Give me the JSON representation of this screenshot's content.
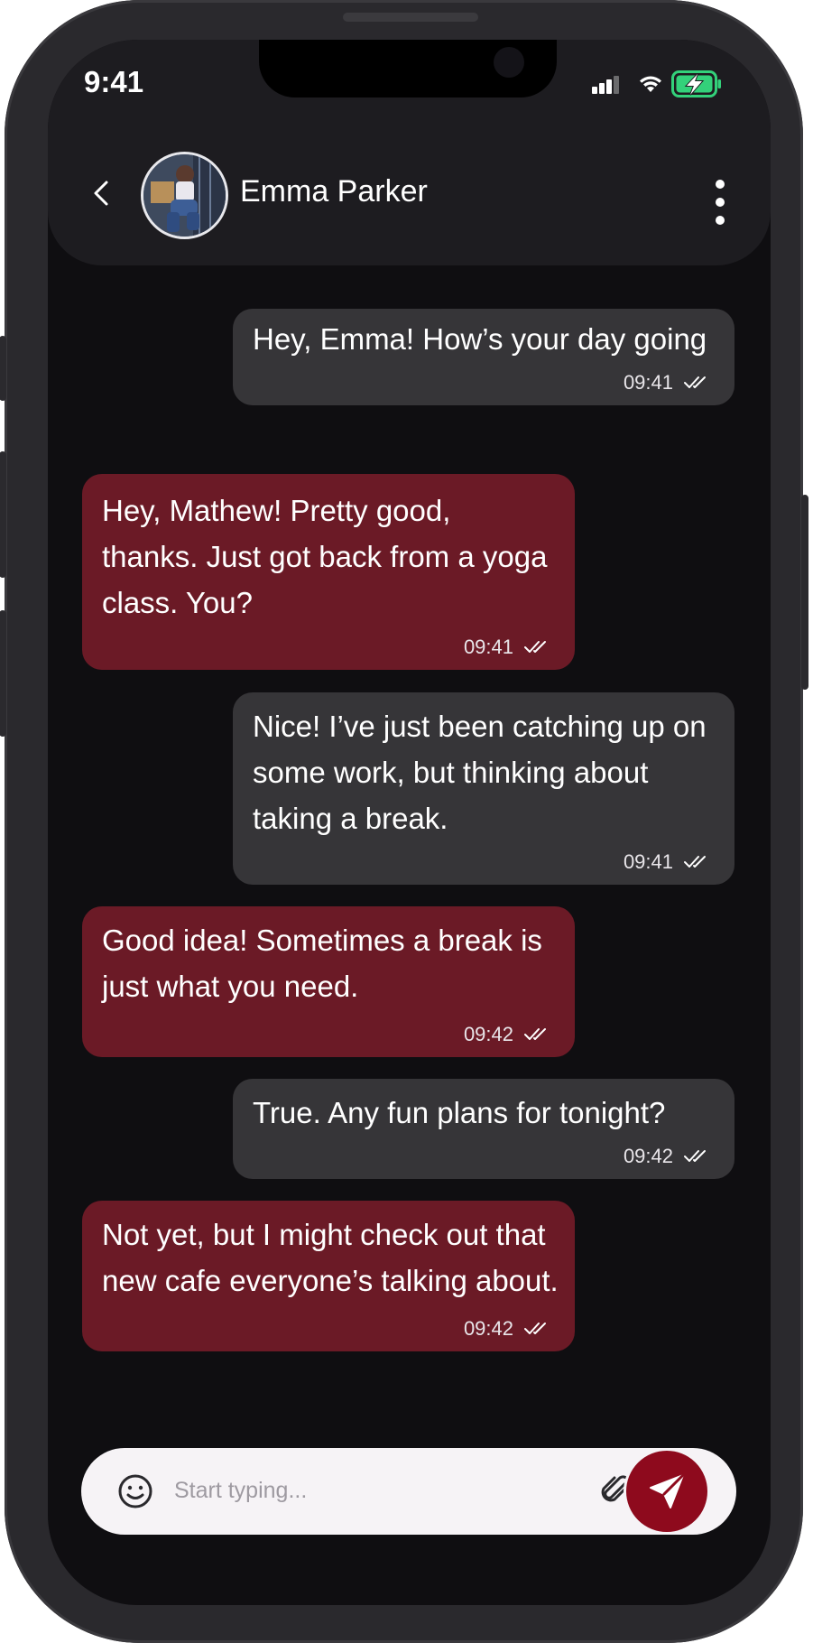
{
  "status_bar": {
    "time": "9:41"
  },
  "header": {
    "contact_name": "Emma Parker"
  },
  "messages": [
    {
      "direction": "outgoing",
      "text": "Hey, Emma! How’s your day going",
      "time": "09:41",
      "status_icon": "double-check-icon"
    },
    {
      "direction": "incoming",
      "text": "Hey, Mathew! Pretty good,\nthanks. Just got back from a yoga\nclass. You?",
      "time": "09:41",
      "status_icon": "double-check-icon"
    },
    {
      "direction": "outgoing",
      "text": "Nice! I’ve just been catching up on\nsome work, but thinking about\ntaking a break.",
      "time": "09:41",
      "status_icon": "double-check-icon"
    },
    {
      "direction": "incoming",
      "text": "Good idea! Sometimes a break is\njust what you need.",
      "time": "09:42",
      "status_icon": "double-check-icon"
    },
    {
      "direction": "outgoing",
      "text": "True. Any fun plans for tonight?",
      "time": "09:42",
      "status_icon": "double-check-icon"
    },
    {
      "direction": "incoming",
      "text": "Not yet, but I might check out that\nnew cafe everyone’s talking about.",
      "time": "09:42",
      "status_icon": "double-check-icon"
    }
  ],
  "composer": {
    "placeholder": "Start typing..."
  },
  "icons": [
    "back-icon",
    "avatar",
    "more-vertical-icon",
    "signal-icon",
    "wifi-icon",
    "battery-charging-icon",
    "emoji-icon",
    "attach-icon",
    "send-icon"
  ],
  "colors": {
    "background": "#0f0e11",
    "header": "#1d1c20",
    "outgoing_bubble": "#363538",
    "incoming_bubble": "#6b1a26",
    "send_button": "#8e0a1d",
    "battery": "#33d17a"
  }
}
